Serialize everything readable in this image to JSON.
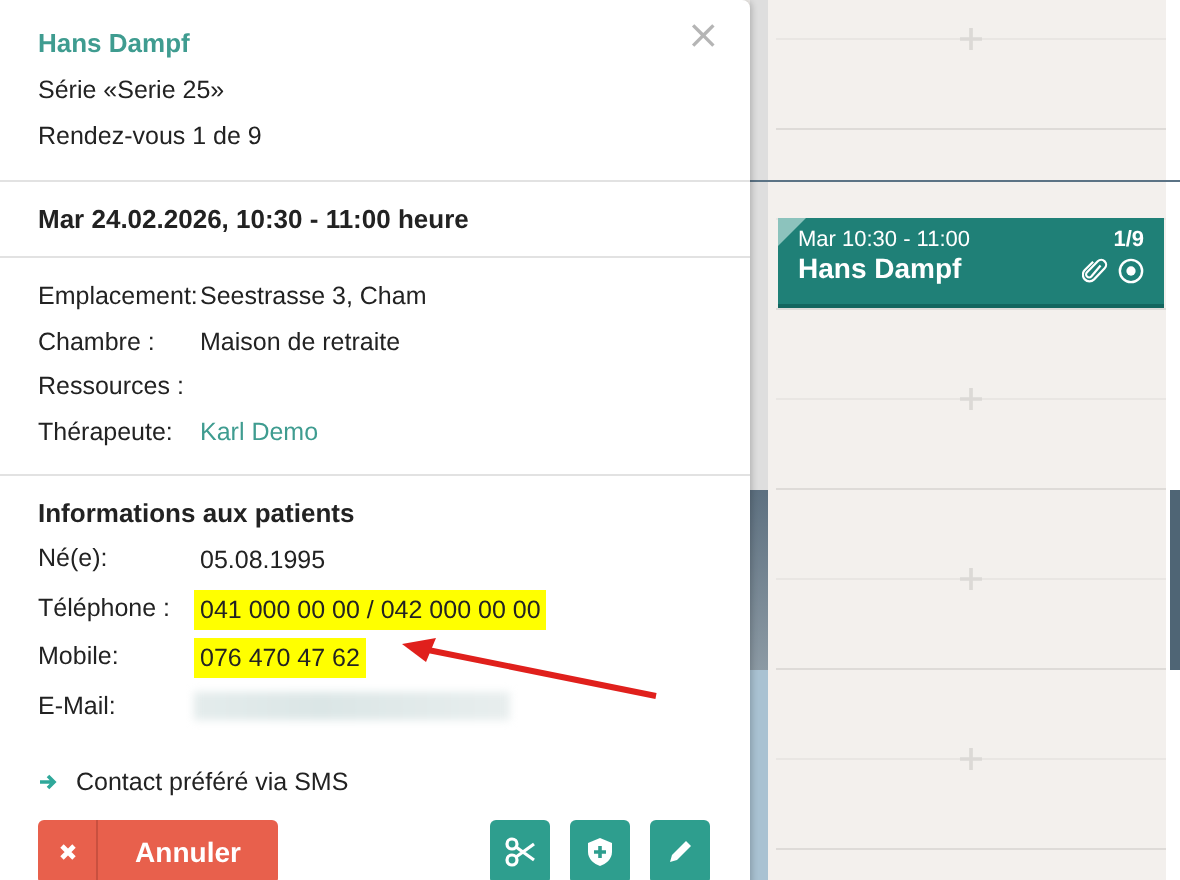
{
  "appointment_popup": {
    "patient_name": "Hans Dampf",
    "series": "Série «Serie 25»",
    "occurrence": "Rendez-vous 1 de 9",
    "close": "×",
    "datetime": "Mar 24.02.2026, 10:30 - 11:00 heure",
    "details": [
      {
        "label": "Emplacement:",
        "value": "Seestrasse 3, Cham",
        "kind": "text"
      },
      {
        "label": "Chambre :",
        "value": "Maison de retraite",
        "kind": "text"
      },
      {
        "label": "Ressources :",
        "kind": "text"
      },
      {
        "label": "Thérapeute:",
        "value": "Karl Demo",
        "kind": "link"
      }
    ],
    "patient_info": {
      "title": "Informations aux patients",
      "fields": [
        {
          "label": "Né(e):",
          "value": "05.08.1995",
          "kind": "text",
          "highlighted": false
        },
        {
          "label": "Téléphone :",
          "value": "041 000 00 00 / 042 000 00 00",
          "kind": "text",
          "highlighted": true
        },
        {
          "label": "Mobile:",
          "value": "076 470 47 62",
          "kind": "text",
          "highlighted": true
        },
        {
          "label": "E-Mail:",
          "kind": "blurred"
        }
      ]
    },
    "contact_preference": "Contact préféré via SMS",
    "cancel_button": "Annuler",
    "action_buttons": [
      {
        "kind": "cut"
      },
      {
        "kind": "shield"
      },
      {
        "kind": "edit"
      }
    ]
  },
  "calendar": {
    "event": {
      "time": "Mar 10:30 - 11:00",
      "name": "Hans Dampf",
      "counter": "1/9",
      "has_attachment": true
    }
  }
}
